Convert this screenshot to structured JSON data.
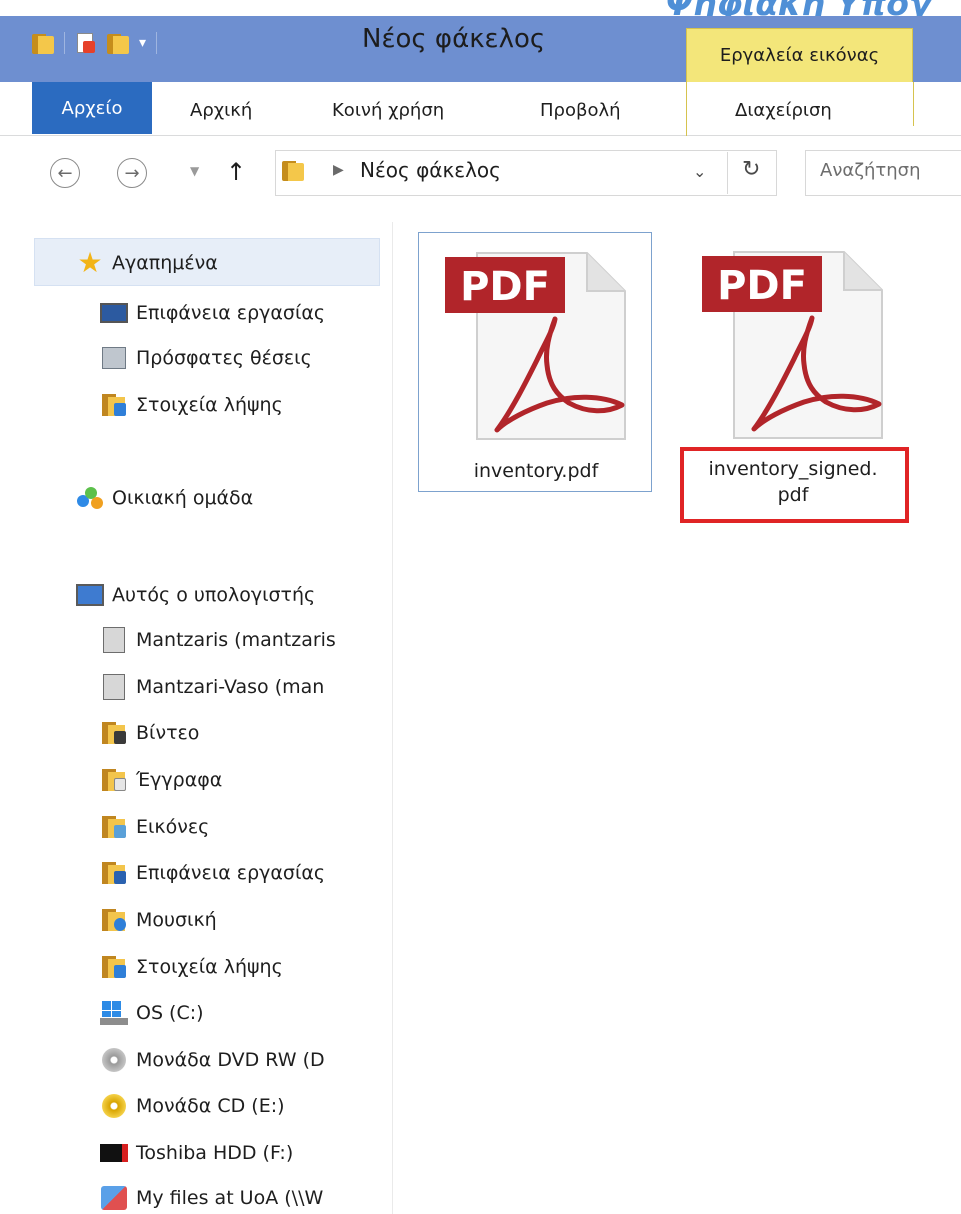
{
  "corner_text": "Ψηφιακή Υπογ",
  "window": {
    "title": "Νέος φάκελος"
  },
  "contextual_tab": "Εργαλεία εικόνας",
  "ribbon": {
    "file_tab": "Αρχείο",
    "tabs": [
      "Αρχική",
      "Κοινή χρήση",
      "Προβολή",
      "Διαχείριση"
    ]
  },
  "address": {
    "path": "Νέος φάκελος",
    "search_placeholder": "Αναζήτηση"
  },
  "nav": {
    "favorites": "Αγαπημένα",
    "favorites_items": [
      "Επιφάνεια εργασίας",
      "Πρόσφατες θέσεις",
      "Στοιχεία λήψης"
    ],
    "homegroup": "Οικιακή ομάδα",
    "this_pc": "Αυτός ο υπολογιστής",
    "pc_items": [
      "Mantzaris (mantzaris",
      "Mantzari-Vaso (man",
      "Βίντεο",
      "Έγγραφα",
      "Εικόνες",
      "Επιφάνεια εργασίας",
      "Μουσική",
      "Στοιχεία λήψης",
      "OS (C:)",
      "Μονάδα DVD RW (D",
      "Μονάδα CD (E:)",
      "Toshiba HDD (F:)",
      "My files at UoA (\\\\W"
    ]
  },
  "files": [
    {
      "name": "inventory.pdf",
      "badge": "PDF"
    },
    {
      "name_line1": "inventory_signed.",
      "name_line2": "pdf",
      "badge": "PDF"
    }
  ],
  "colors": {
    "title_bar": "#6e8fd0",
    "file_tab": "#2b6bc0",
    "contextual_tab": "#f3e67a",
    "pdf_red": "#b1252a",
    "highlight": "#e02425"
  }
}
